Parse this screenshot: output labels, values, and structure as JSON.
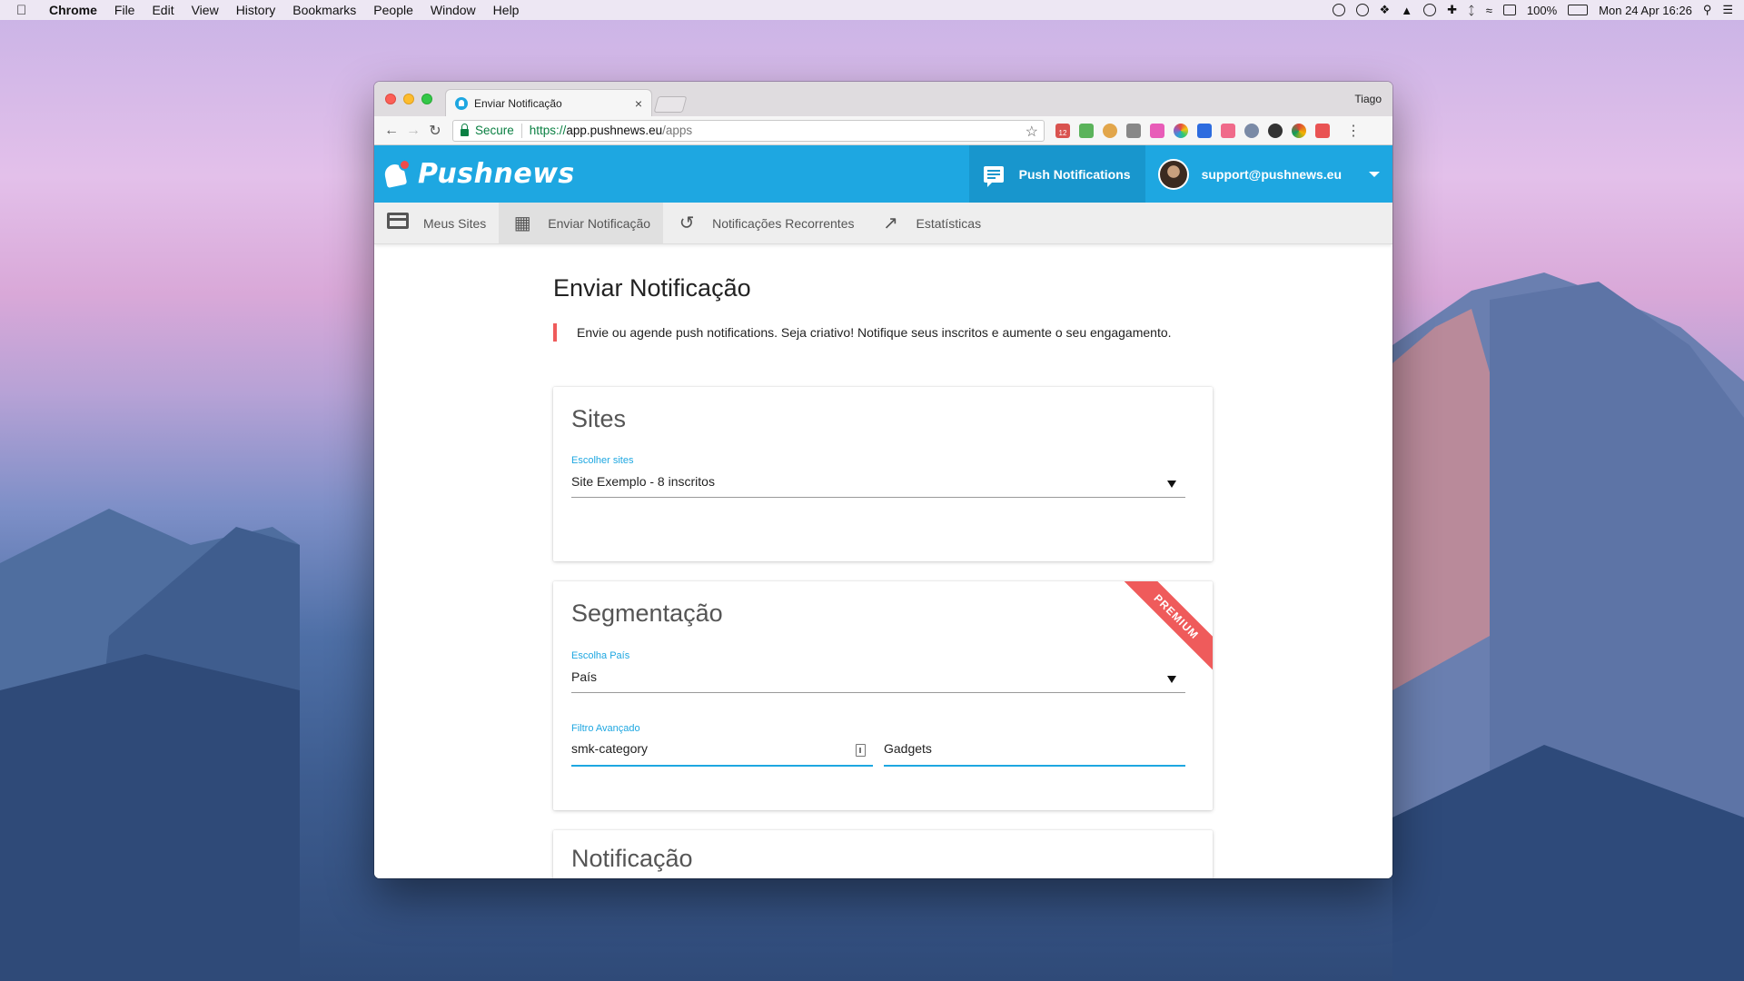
{
  "menubar": {
    "app": "Chrome",
    "items": [
      "File",
      "Edit",
      "View",
      "History",
      "Bookmarks",
      "People",
      "Window",
      "Help"
    ],
    "battery": "100%",
    "datetime": "Mon 24 Apr  16:26"
  },
  "browser": {
    "tab_title": "Enviar Notificação",
    "tab_close": "×",
    "profile": "Tiago",
    "secure_label": "Secure",
    "url_scheme": "https://",
    "url_domain": "app.pushnews.eu",
    "url_path": "/apps",
    "ext_badge": "12"
  },
  "app": {
    "brand": "Pushnews",
    "push_button": "Push Notifications",
    "user_email": "support@pushnews.eu",
    "nav": [
      {
        "label": "Meus Sites",
        "icon": "web-icon"
      },
      {
        "label": "Enviar Notificação",
        "icon": "chat-icon"
      },
      {
        "label": "Notificações Recorrentes",
        "icon": "history-icon"
      },
      {
        "label": "Estatísticas",
        "icon": "trending-up-icon"
      }
    ]
  },
  "page": {
    "title": "Enviar Notificação",
    "callout": "Envie ou agende push notifications. Seja criativo! Notifique seus inscritos e aumente o seu engagamento.",
    "sites_card": {
      "title": "Sites",
      "label": "Escolher sites",
      "value": "Site Exemplo - 8 inscritos"
    },
    "segment_card": {
      "title": "Segmentação",
      "ribbon": "PREMIUM",
      "country_label": "Escolha País",
      "country_value": "País",
      "filter_label": "Filtro Avançado",
      "filter_key": "smk-category",
      "filter_value": "Gadgets"
    },
    "notif_card": {
      "title": "Notificação"
    }
  },
  "colors": {
    "brand_blue": "#1ea7e1",
    "accent_red": "#ef5b5b"
  }
}
